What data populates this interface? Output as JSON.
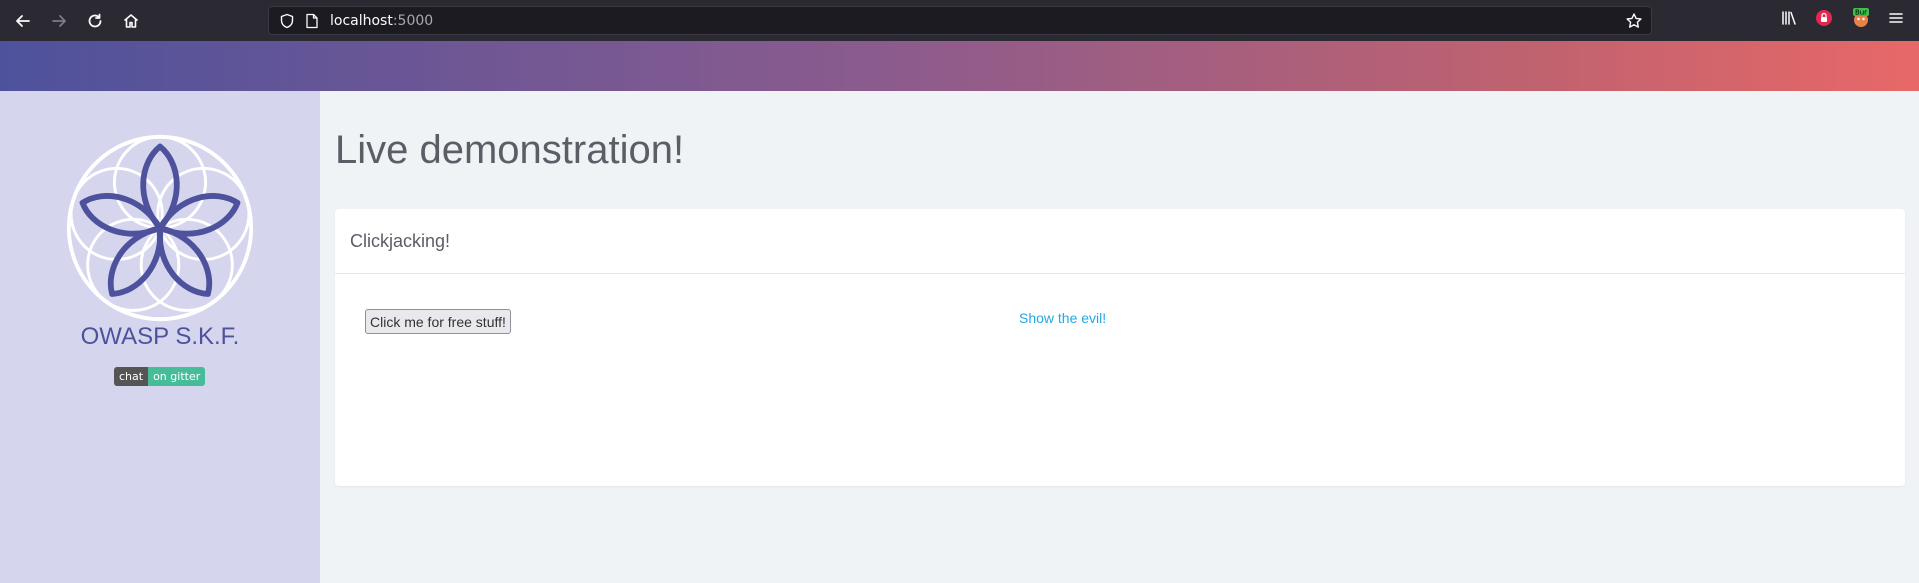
{
  "browser": {
    "url_host": "localhost",
    "url_port": ":5000"
  },
  "sidebar": {
    "brand": "OWASP S.K.F.",
    "badge_left": "chat",
    "badge_right": "on gitter"
  },
  "main": {
    "title": "Live demonstration!",
    "card_title": "Clickjacking!",
    "button_label": "Click me for free stuff!",
    "link_label": "Show the evil!"
  },
  "colors": {
    "brand": "#4e529c",
    "link": "#23a9e1",
    "sidebar_bg": "#d5d6ee",
    "page_bg": "#f0f3f6"
  }
}
